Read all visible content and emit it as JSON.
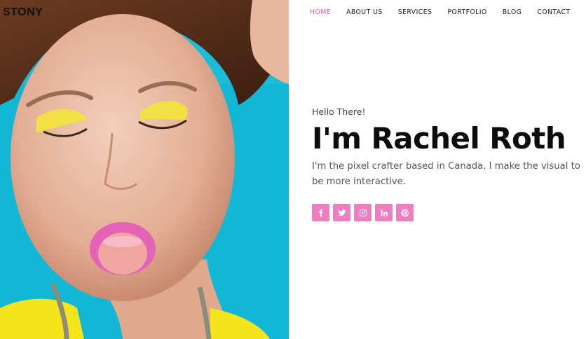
{
  "brand": {
    "logo": "STONY"
  },
  "nav": {
    "items": [
      {
        "label": "HOME",
        "active": true
      },
      {
        "label": "ABOUT US",
        "active": false
      },
      {
        "label": "SERVICES",
        "active": false
      },
      {
        "label": "PORTFOLIO",
        "active": false
      },
      {
        "label": "BLOG",
        "active": false
      },
      {
        "label": "CONTACT",
        "active": false
      }
    ]
  },
  "hero": {
    "greeting": "Hello There!",
    "name": "I'm Rachel Roth",
    "bio": "I'm the pixel crafter based in Canada. I make the visual to be more interactive."
  },
  "social": {
    "icons": [
      "facebook-icon",
      "twitter-icon",
      "instagram-icon",
      "linkedin-icon",
      "pinterest-icon"
    ]
  },
  "colors": {
    "accent": "#e5589d",
    "social_bg": "#ee7ec0",
    "photo_bg": "#12b7d6"
  }
}
